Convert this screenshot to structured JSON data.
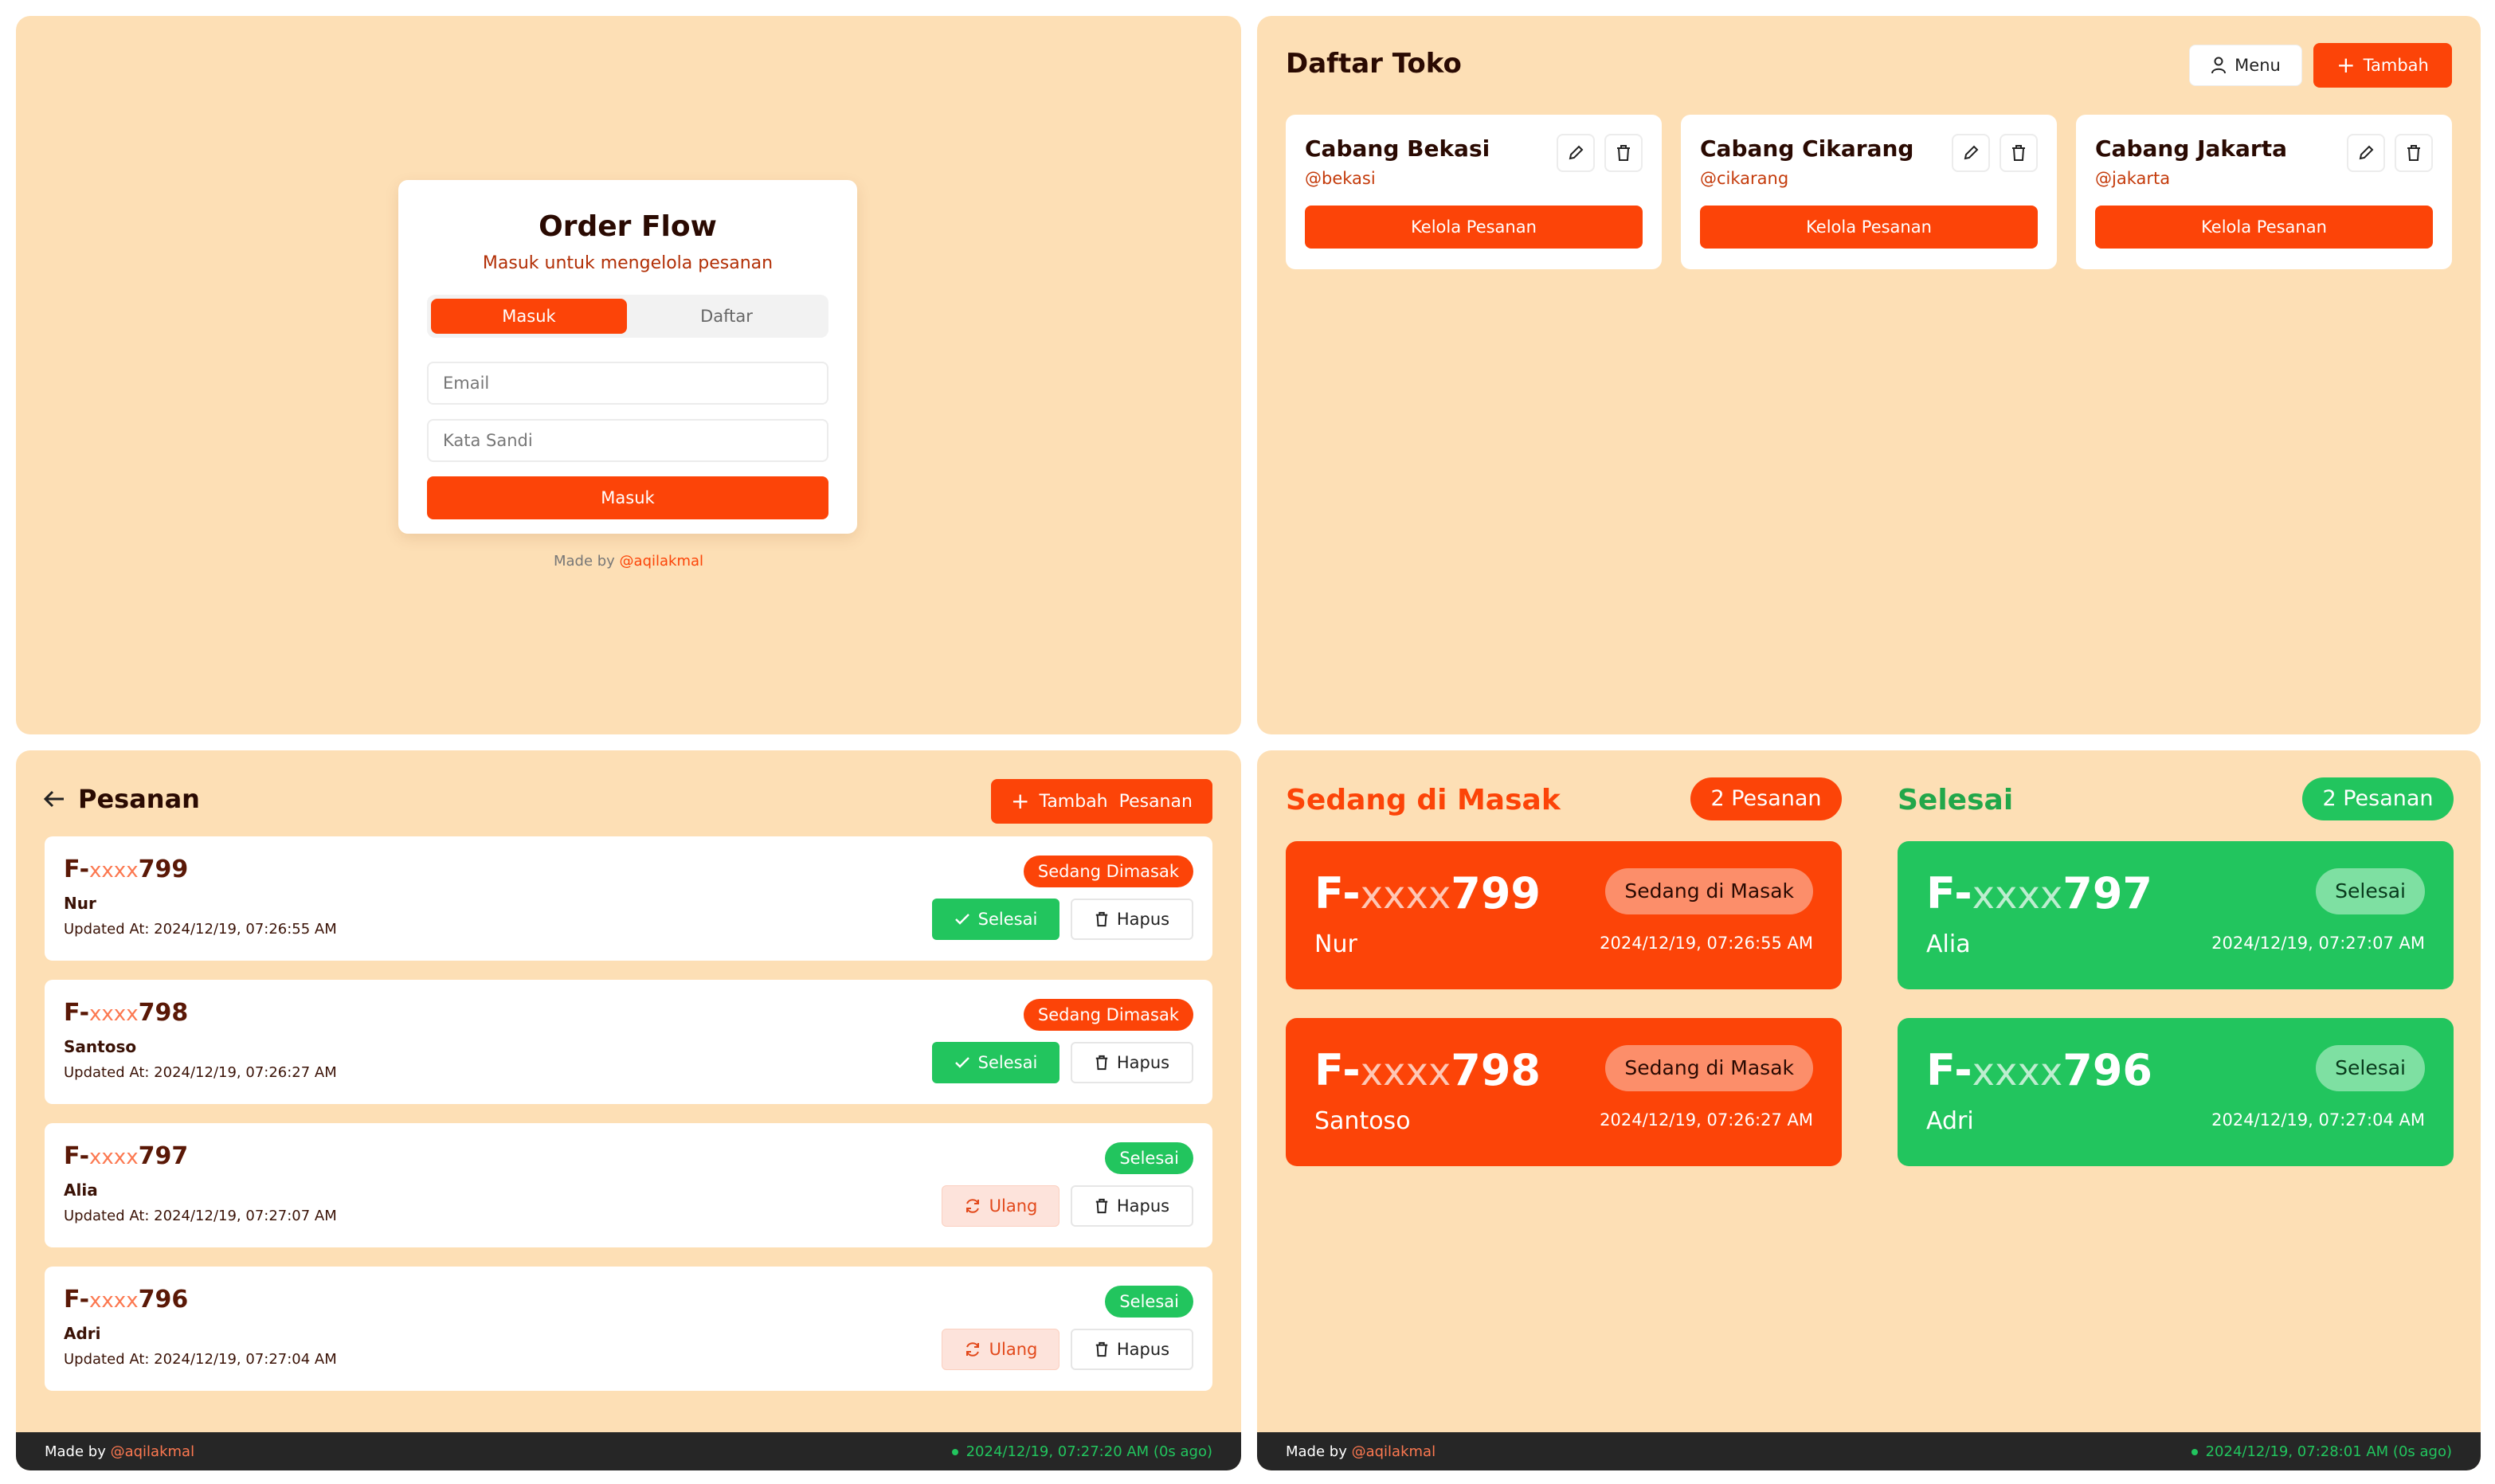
{
  "colors": {
    "accent": "#fc4408",
    "success": "#22c55e",
    "panel_bg": "#fddfb5",
    "footer_bg": "#262626"
  },
  "login": {
    "title": "Order Flow",
    "subtitle": "Masuk untuk mengelola pesanan",
    "tabs": [
      "Masuk",
      "Daftar"
    ],
    "email_placeholder": "Email",
    "password_placeholder": "Kata Sandi",
    "submit_label": "Masuk",
    "made_by_prefix": "Made by ",
    "made_by_handle": "@aqilakmal"
  },
  "stores": {
    "title": "Daftar Toko",
    "menu_label": "Menu",
    "add_label": "Tambah",
    "items": [
      {
        "name": "Cabang Bekasi",
        "handle": "@bekasi",
        "action": "Kelola Pesanan"
      },
      {
        "name": "Cabang Cikarang",
        "handle": "@cikarang",
        "action": "Kelola Pesanan"
      },
      {
        "name": "Cabang Jakarta",
        "handle": "@jakarta",
        "action": "Kelola Pesanan"
      }
    ]
  },
  "orders": {
    "title": "Pesanan",
    "add_label": "Tambah  Pesanan",
    "items": [
      {
        "prefix": "F-",
        "mask": "xxxx",
        "number": "799",
        "customer": "Nur",
        "updated": "Updated At: 2024/12/19, 07:26:55 AM",
        "status": "Sedang Dimasak",
        "primary_action": "Selesai",
        "delete": "Hapus"
      },
      {
        "prefix": "F-",
        "mask": "xxxx",
        "number": "798",
        "customer": "Santoso",
        "updated": "Updated At: 2024/12/19, 07:26:27 AM",
        "status": "Sedang Dimasak",
        "primary_action": "Selesai",
        "delete": "Hapus"
      },
      {
        "prefix": "F-",
        "mask": "xxxx",
        "number": "797",
        "customer": "Alia",
        "updated": "Updated At: 2024/12/19, 07:27:07 AM",
        "status": "Selesai",
        "primary_action": "Ulang",
        "delete": "Hapus"
      },
      {
        "prefix": "F-",
        "mask": "xxxx",
        "number": "796",
        "customer": "Adri",
        "updated": "Updated At: 2024/12/19, 07:27:04 AM",
        "status": "Selesai",
        "primary_action": "Ulang",
        "delete": "Hapus"
      }
    ],
    "footer": {
      "made_by_prefix": "Made by ",
      "made_by_handle": "@aqilakmal",
      "time": "2024/12/19, 07:27:20 AM (0s ago)"
    }
  },
  "kitchen": {
    "cooking_title": "Sedang di Masak",
    "cooking_count": "2 Pesanan",
    "done_title": "Selesai",
    "done_count": "2 Pesanan",
    "cooking": [
      {
        "prefix": "F-",
        "mask": "xxxx",
        "number": "799",
        "customer": "Nur",
        "status": "Sedang di Masak",
        "time": "2024/12/19, 07:26:55 AM"
      },
      {
        "prefix": "F-",
        "mask": "xxxx",
        "number": "798",
        "customer": "Santoso",
        "status": "Sedang di Masak",
        "time": "2024/12/19, 07:26:27 AM"
      }
    ],
    "done": [
      {
        "prefix": "F-",
        "mask": "xxxx",
        "number": "797",
        "customer": "Alia",
        "status": "Selesai",
        "time": "2024/12/19, 07:27:07 AM"
      },
      {
        "prefix": "F-",
        "mask": "xxxx",
        "number": "796",
        "customer": "Adri",
        "status": "Selesai",
        "time": "2024/12/19, 07:27:04 AM"
      }
    ],
    "footer": {
      "made_by_prefix": "Made by ",
      "made_by_handle": "@aqilakmal",
      "time": "2024/12/19, 07:28:01 AM (0s ago)"
    }
  }
}
